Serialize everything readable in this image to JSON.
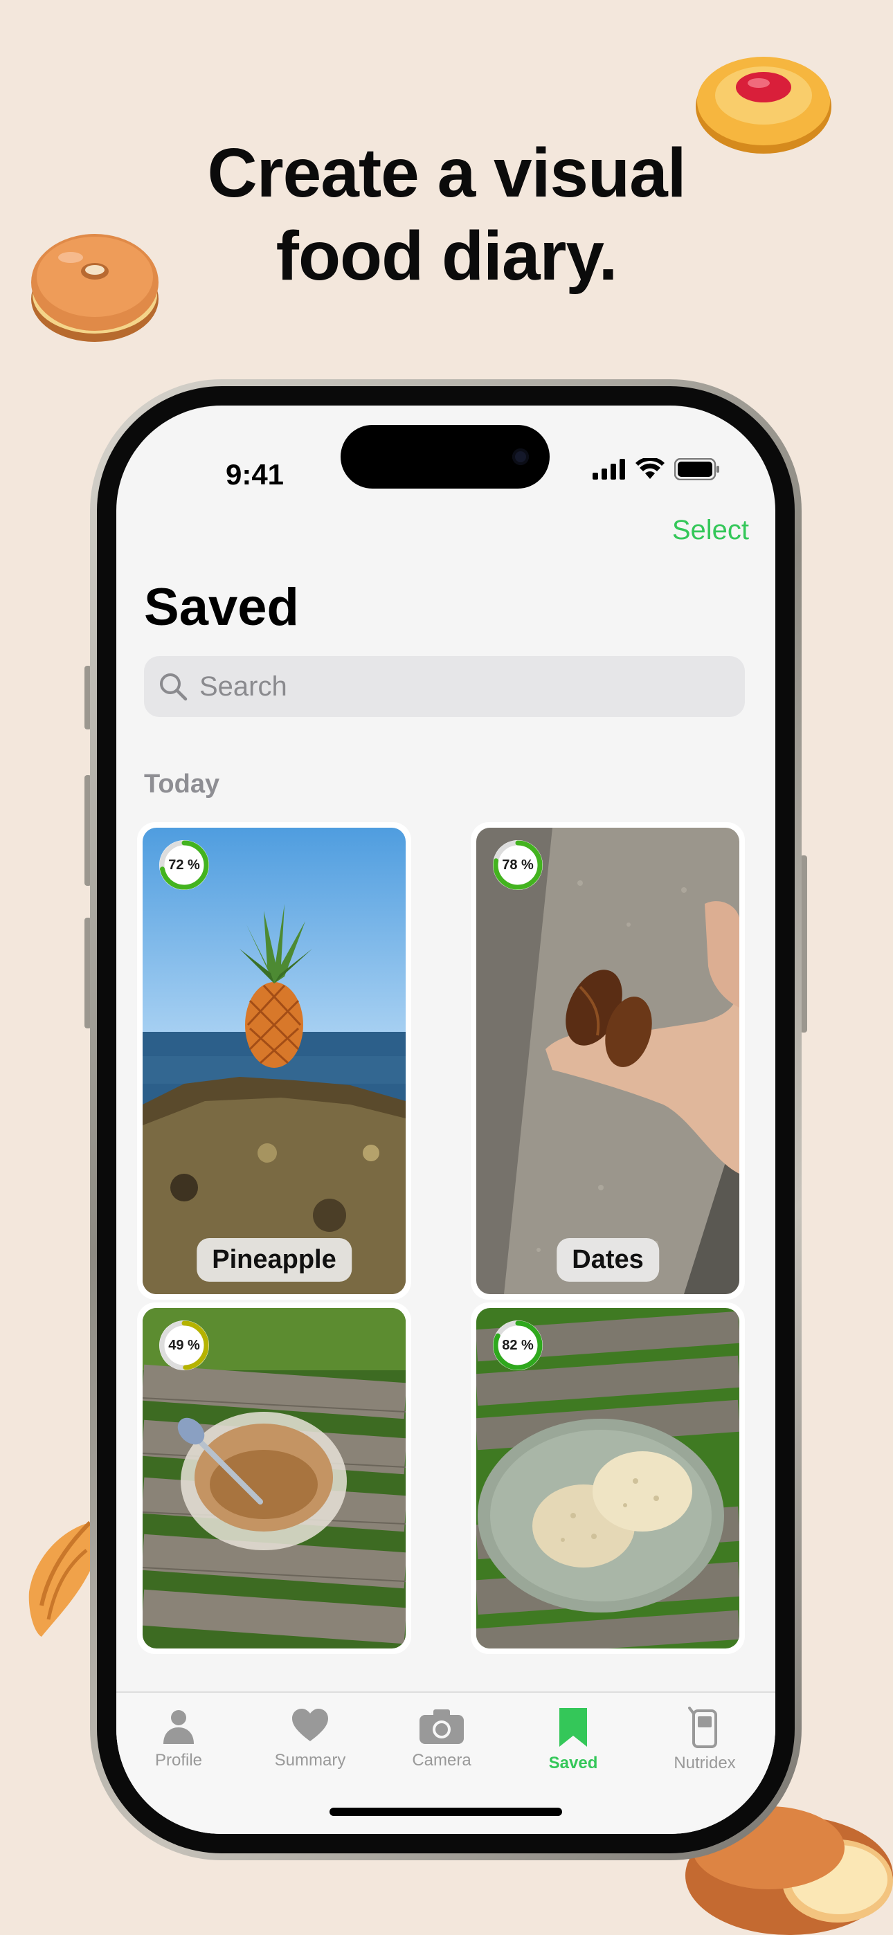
{
  "headline": {
    "line1": "Create a visual",
    "line2": "food diary."
  },
  "status_bar": {
    "time": "9:41"
  },
  "header": {
    "select_label": "Select",
    "title": "Saved"
  },
  "search": {
    "placeholder": "Search"
  },
  "section": {
    "label": "Today"
  },
  "items": [
    {
      "name": "Pineapple",
      "score_label": "72 %",
      "score": 72,
      "ring_color": "#43b31f"
    },
    {
      "name": "Dates",
      "score_label": "78 %",
      "score": 78,
      "ring_color": "#43b31f"
    },
    {
      "name": "",
      "score_label": "49 %",
      "score": 49,
      "ring_color": "#b5b300"
    },
    {
      "name": "",
      "score_label": "82 %",
      "score": 82,
      "ring_color": "#2fa81d"
    }
  ],
  "tabs": [
    {
      "label": "Profile",
      "icon": "person-icon",
      "active": false
    },
    {
      "label": "Summary",
      "icon": "heart-icon",
      "active": false
    },
    {
      "label": "Camera",
      "icon": "camera-icon",
      "active": false
    },
    {
      "label": "Saved",
      "icon": "bookmark-icon",
      "active": true
    },
    {
      "label": "Nutridex",
      "icon": "nutridex-device-icon",
      "active": false
    }
  ],
  "colors": {
    "accent": "#34c759",
    "background": "#f3e7dc"
  }
}
